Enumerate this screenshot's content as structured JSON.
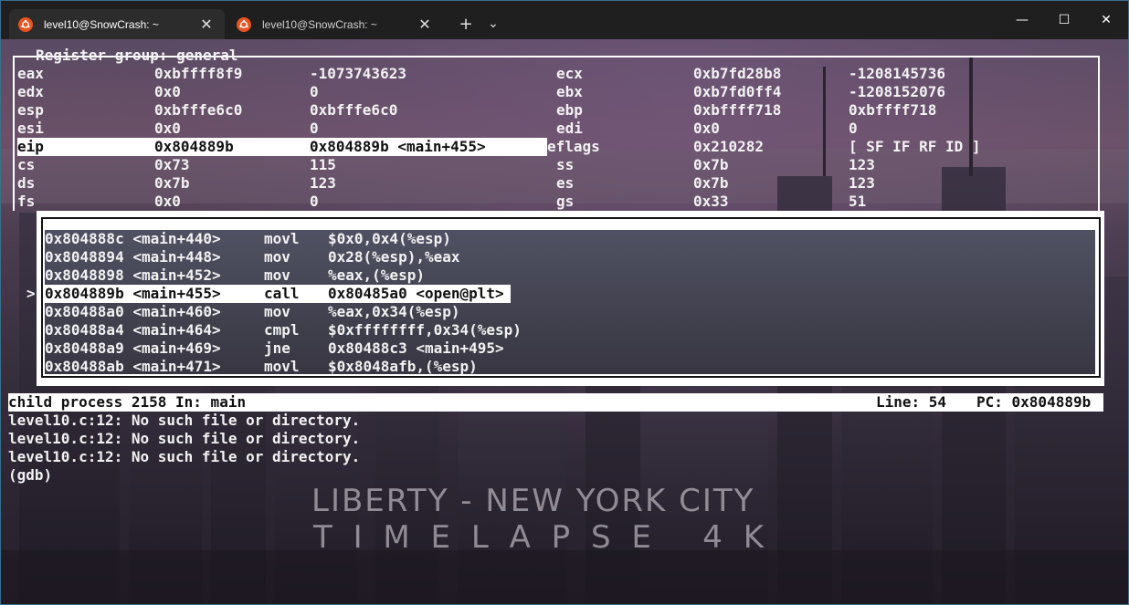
{
  "tabs": [
    {
      "label": "level10@SnowCrash: ~",
      "active": true
    },
    {
      "label": "level10@SnowCrash: ~",
      "active": false
    }
  ],
  "titlebar": {
    "new_tab": "+",
    "dropdown": "⌄",
    "minimize": "—",
    "maximize": "☐",
    "close": "✕"
  },
  "registers": {
    "title": "Register group: general",
    "rows": [
      {
        "l_name": "eax",
        "l_hex": "0xbffff8f9",
        "l_val": "-1073743623",
        "r_name": "ecx",
        "r_hex": "0xb7fd28b8",
        "r_val": "-1208145736"
      },
      {
        "l_name": "edx",
        "l_hex": "0x0",
        "l_val": "0",
        "r_name": "ebx",
        "r_hex": "0xb7fd0ff4",
        "r_val": "-1208152076"
      },
      {
        "l_name": "esp",
        "l_hex": "0xbfffe6c0",
        "l_val": "0xbfffe6c0",
        "r_name": "ebp",
        "r_hex": "0xbffff718",
        "r_val": "0xbffff718"
      },
      {
        "l_name": "esi",
        "l_hex": "0x0",
        "l_val": "0",
        "r_name": "edi",
        "r_hex": "0x0",
        "r_val": "0"
      },
      {
        "l_name": "eip",
        "l_hex": "0x804889b",
        "l_val": "0x804889b <main+455>",
        "r_name": "eflags",
        "r_hex": "0x210282",
        "r_val": "[ SF IF RF ID ]"
      },
      {
        "l_name": "cs",
        "l_hex": "0x73",
        "l_val": "115",
        "r_name": "ss",
        "r_hex": "0x7b",
        "r_val": "123"
      },
      {
        "l_name": "ds",
        "l_hex": "0x7b",
        "l_val": "123",
        "r_name": "es",
        "r_hex": "0x7b",
        "r_val": "123"
      },
      {
        "l_name": "fs",
        "l_hex": "0x0",
        "l_val": "0",
        "r_name": "gs",
        "r_hex": "0x33",
        "r_val": "51"
      }
    ]
  },
  "asm": {
    "marker": ">",
    "rows": [
      {
        "addr": "0x804888c <main+440>",
        "op": "movl",
        "args": "$0x0,0x4(%esp)"
      },
      {
        "addr": "0x8048894 <main+448>",
        "op": "mov",
        "args": "0x28(%esp),%eax"
      },
      {
        "addr": "0x8048898 <main+452>",
        "op": "mov",
        "args": "%eax,(%esp)"
      },
      {
        "addr": "0x804889b <main+455>",
        "op": "call",
        "args": "0x80485a0 <open@plt>"
      },
      {
        "addr": "0x80488a0 <main+460>",
        "op": "mov",
        "args": "%eax,0x34(%esp)"
      },
      {
        "addr": "0x80488a4 <main+464>",
        "op": "cmpl",
        "args": "$0xffffffff,0x34(%esp)"
      },
      {
        "addr": "0x80488a9 <main+469>",
        "op": "jne",
        "args": "0x80488c3 <main+495>"
      },
      {
        "addr": "0x80488ab <main+471>",
        "op": "movl",
        "args": "$0x8048afb,(%esp)"
      }
    ]
  },
  "status": {
    "left": "child process 2158 In: main",
    "line": "Line: 54",
    "pc": "PC: 0x804889b"
  },
  "console": [
    "level10.c:12: No such file or directory.",
    "level10.c:12: No such file or directory.",
    "level10.c:12: No such file or directory.",
    "(gdb)"
  ],
  "wallpaper": {
    "line1": "LIBERTY - NEW YORK CITY",
    "line2": "T I M E L A P S E   4 K"
  }
}
